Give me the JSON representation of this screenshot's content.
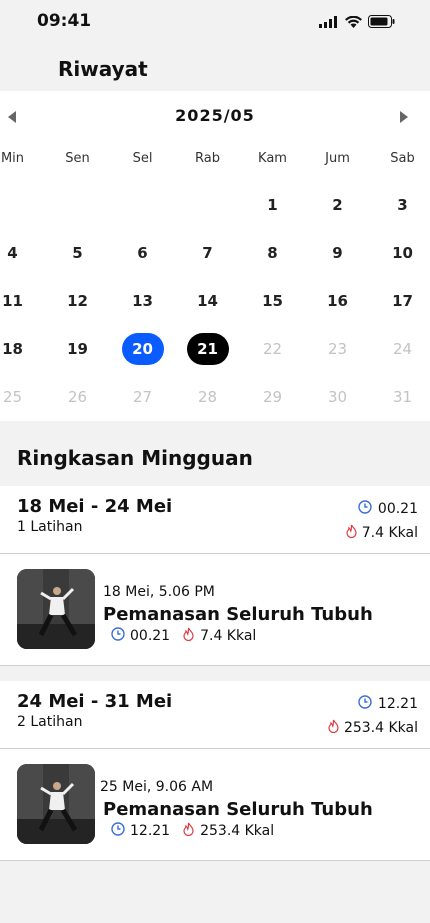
{
  "status": {
    "time": "09:41"
  },
  "header": {
    "title": "Riwayat"
  },
  "calendar": {
    "month": "2025/05",
    "weekdays": [
      "Min",
      "Sen",
      "Sel",
      "Rab",
      "Kam",
      "Jum",
      "Sab"
    ],
    "rows": [
      [
        "",
        "",
        "",
        "",
        "1",
        "2",
        "3"
      ],
      [
        "4",
        "5",
        "6",
        "7",
        "8",
        "9",
        "10"
      ],
      [
        "11",
        "12",
        "13",
        "14",
        "15",
        "16",
        "17"
      ],
      [
        "18",
        "19",
        "20",
        "21",
        "22",
        "23",
        "24"
      ],
      [
        "25",
        "26",
        "27",
        "28",
        "29",
        "30",
        "31"
      ]
    ],
    "selected_day": "20",
    "today": "21",
    "future_from": "22"
  },
  "summary": {
    "title": "Ringkasan Mingguan"
  },
  "weeks": [
    {
      "range": "18 Mei - 24 Mei",
      "count": "1 Latihan",
      "duration": "00.21",
      "calories": "7.4 Kkal",
      "session": {
        "date": "18 Mei, 5.06 PM",
        "name": "Pemanasan Seluruh Tubuh",
        "duration": "00.21",
        "calories": "7.4 Kkal"
      }
    },
    {
      "range": "24 Mei - 31 Mei",
      "count": "2 Latihan",
      "duration": "12.21",
      "calories": "253.4 Kkal",
      "session": {
        "date": "25 Mei, 9.06 AM",
        "name": "Pemanasan Seluruh Tubuh",
        "duration": "12.21",
        "calories": "253.4 Kkal"
      }
    }
  ],
  "colors": {
    "accent": "#0a5cff",
    "today": "#000000",
    "fire": "#e0393e",
    "clock": "#3a6fd8"
  }
}
